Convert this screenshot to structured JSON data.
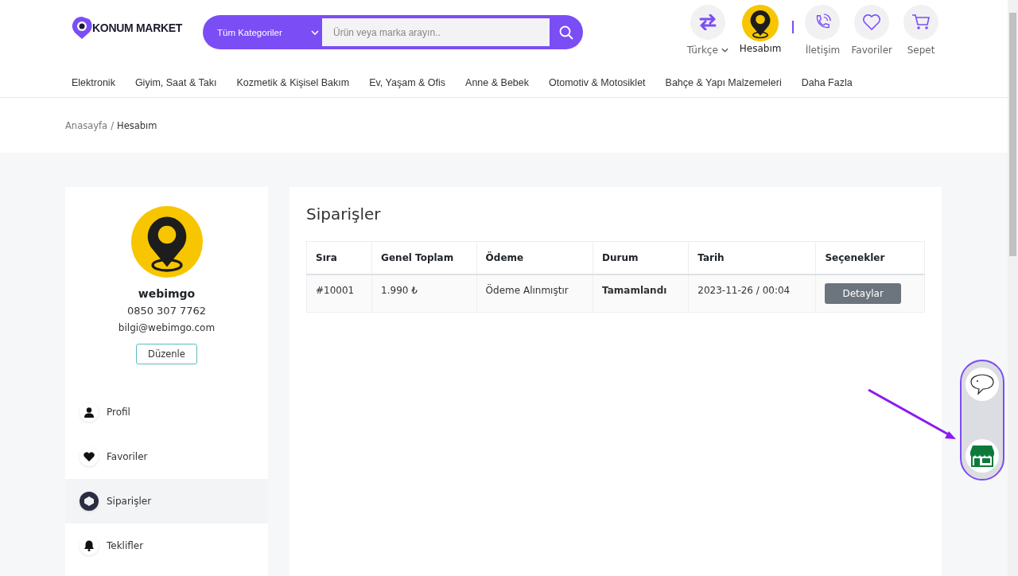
{
  "header": {
    "logo": "KONUM MARKET",
    "search": {
      "category": "Tüm Kategoriler",
      "placeholder": "Ürün veya marka arayın.."
    },
    "actions": [
      {
        "kind": "language",
        "label": "Türkçe"
      },
      {
        "kind": "account",
        "label": "Hesabım"
      },
      {
        "kind": "contact",
        "label": "İletişim"
      },
      {
        "kind": "favorites",
        "label": "Favoriler"
      },
      {
        "kind": "cart",
        "label": "Sepet"
      }
    ]
  },
  "nav": [
    "Elektronik",
    "Giyim, Saat & Takı",
    "Kozmetik & Kişisel Bakım",
    "Ev, Yaşam & Ofis",
    "Anne & Bebek",
    "Otomotiv & Motosiklet",
    "Bahçe & Yapı Malzemeleri",
    "Daha Fazla"
  ],
  "breadcrumb": {
    "separator": "/",
    "items": [
      "Anasayfa",
      "Hesabım"
    ]
  },
  "profile": {
    "name": "webimgo",
    "phone": "0850 307 7762",
    "email": "bilgi@webimgo.com",
    "edit_button": "Düzenle"
  },
  "sidebar": {
    "items": [
      {
        "kind": "user",
        "label": "Profil",
        "selected": false
      },
      {
        "kind": "heart",
        "label": "Favoriler",
        "selected": false
      },
      {
        "kind": "box",
        "label": "Siparişler",
        "selected": true
      },
      {
        "kind": "bell",
        "label": "Teklifler",
        "selected": false
      }
    ]
  },
  "orders": {
    "title": "Siparişler",
    "columns": [
      "Sıra",
      "Genel Toplam",
      "Ödeme",
      "Durum",
      "Tarih",
      "Seçenekler"
    ],
    "rows": [
      {
        "number": "#10001",
        "total": "1.990 ₺",
        "payment": "Ödeme Alınmıştır",
        "status": "Tamamlandı",
        "date": "2023-11-26 / 00:04",
        "action": "Detaylar"
      }
    ]
  }
}
